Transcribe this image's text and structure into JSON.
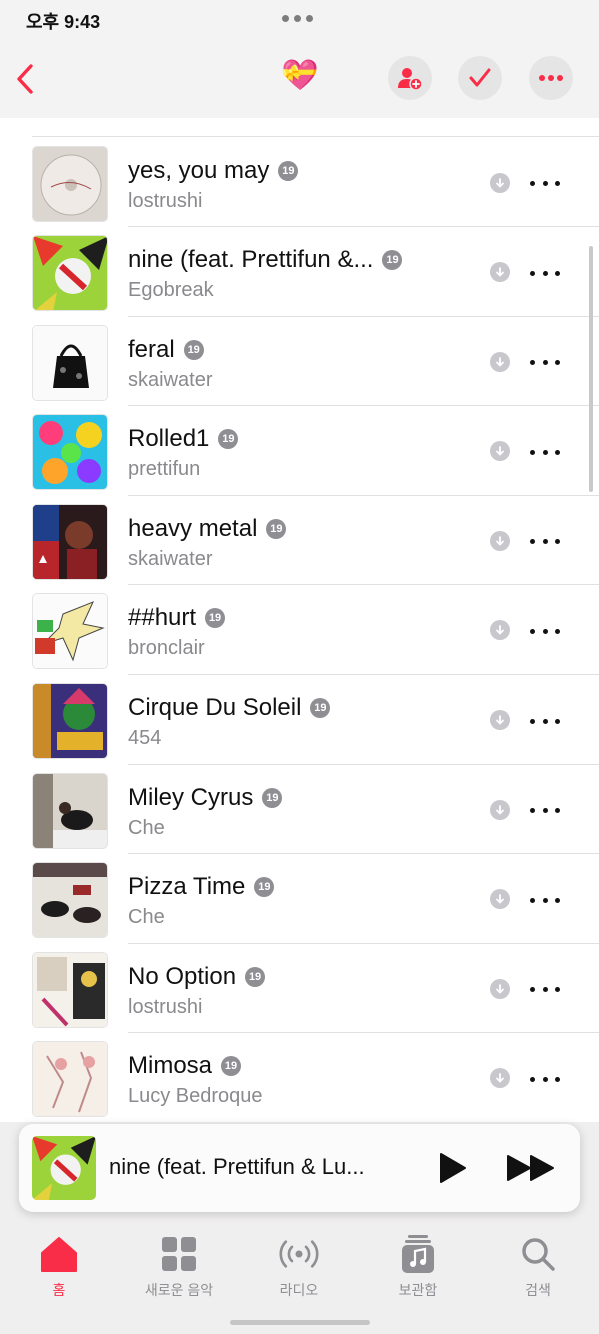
{
  "status_bar": {
    "time": "오후 9:43"
  },
  "header": {
    "playlist_emoji": "💝"
  },
  "icons": {
    "back": "chevron-left-icon",
    "add_person": "person-add-icon",
    "select": "checkmark-icon",
    "more": "ellipsis-icon",
    "download": "download-arrow-icon"
  },
  "colors": {
    "accent": "#fa2d48",
    "explicit": "#8e8e93"
  },
  "explicit_badge": "19",
  "songs": [
    {
      "title": "yes, you may",
      "artist": "lostrushi"
    },
    {
      "title": "nine (feat. Prettifun &...",
      "artist": "Egobreak"
    },
    {
      "title": "feral",
      "artist": "skaiwater"
    },
    {
      "title": "Rolled1",
      "artist": "prettifun"
    },
    {
      "title": "heavy metal",
      "artist": "skaiwater"
    },
    {
      "title": "##hurt",
      "artist": "bronclair"
    },
    {
      "title": "Cirque Du Soleil",
      "artist": "454"
    },
    {
      "title": "Miley Cyrus",
      "artist": "Che"
    },
    {
      "title": "Pizza Time",
      "artist": "Che"
    },
    {
      "title": "No Option",
      "artist": "lostrushi"
    },
    {
      "title": "Mimosa",
      "artist": "Lucy Bedroque"
    }
  ],
  "now_playing": {
    "title": "nine (feat. Prettifun & Lu..."
  },
  "tabs": [
    {
      "label": "홈",
      "icon": "home-icon",
      "active": true
    },
    {
      "label": "새로운 음악",
      "icon": "grid-icon",
      "active": false
    },
    {
      "label": "라디오",
      "icon": "radio-waves-icon",
      "active": false
    },
    {
      "label": "보관함",
      "icon": "library-music-icon",
      "active": false
    },
    {
      "label": "검색",
      "icon": "search-icon",
      "active": false
    }
  ]
}
